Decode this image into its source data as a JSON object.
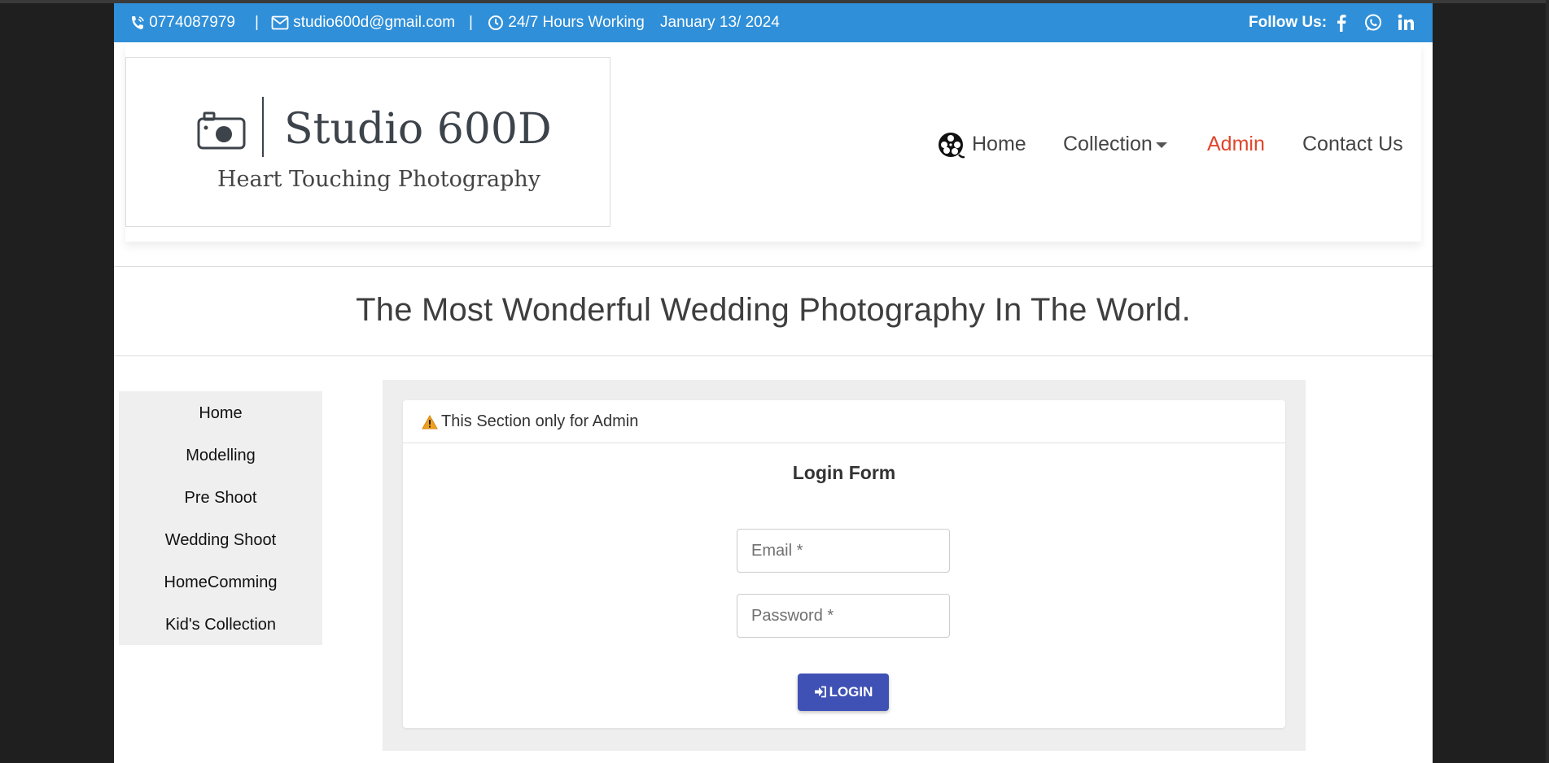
{
  "topbar": {
    "phone": "0774087979",
    "separator": "|",
    "email": "studio600d@gmail.com",
    "hours": "24/7 Hours Working",
    "date": "January 13/ 2024",
    "follow_label": "Follow Us:",
    "social_icons": [
      "facebook-icon",
      "whatsapp-icon",
      "linkedin-icon"
    ]
  },
  "logo": {
    "title": "Studio 600D",
    "subtitle": "Heart Touching Photography"
  },
  "nav": {
    "home": "Home",
    "collection": "Collection",
    "admin": "Admin",
    "contact": "Contact Us"
  },
  "hero": {
    "title": "The Most Wonderful Wedding Photography In The World."
  },
  "sidebar": {
    "items": [
      "Home",
      "Modelling",
      "Pre Shoot",
      "Wedding Shoot",
      "HomeComming",
      "Kid's Collection"
    ]
  },
  "login": {
    "notice": "This Section only for Admin",
    "title": "Login Form",
    "email_placeholder": "Email *",
    "password_placeholder": "Password *",
    "button": "LOGIN"
  },
  "colors": {
    "topbar": "#2f8fd8",
    "nav_active": "#e0452b",
    "button": "#3f51b5"
  }
}
